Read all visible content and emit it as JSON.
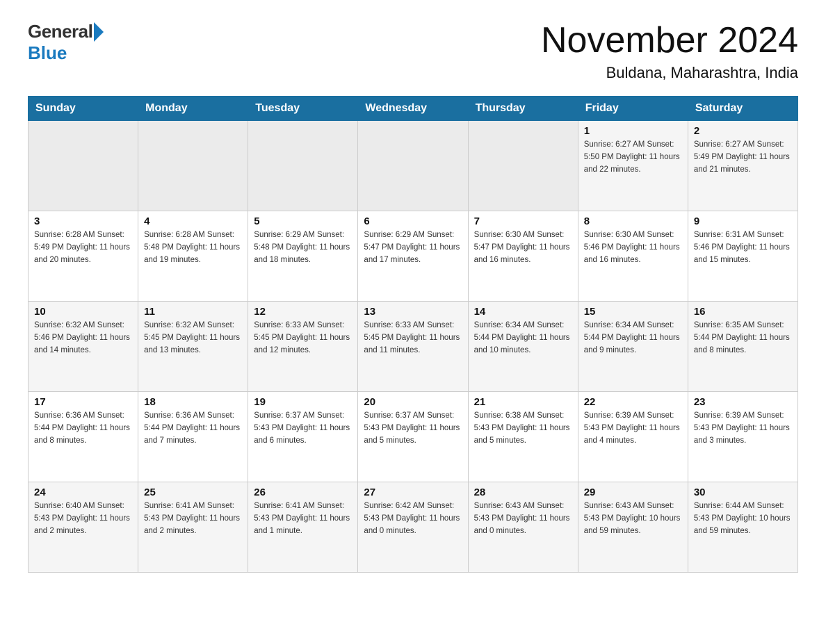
{
  "header": {
    "logo_general": "General",
    "logo_blue": "Blue",
    "month_title": "November 2024",
    "location": "Buldana, Maharashtra, India"
  },
  "days_of_week": [
    "Sunday",
    "Monday",
    "Tuesday",
    "Wednesday",
    "Thursday",
    "Friday",
    "Saturday"
  ],
  "weeks": [
    [
      {
        "day": "",
        "info": ""
      },
      {
        "day": "",
        "info": ""
      },
      {
        "day": "",
        "info": ""
      },
      {
        "day": "",
        "info": ""
      },
      {
        "day": "",
        "info": ""
      },
      {
        "day": "1",
        "info": "Sunrise: 6:27 AM\nSunset: 5:50 PM\nDaylight: 11 hours\nand 22 minutes."
      },
      {
        "day": "2",
        "info": "Sunrise: 6:27 AM\nSunset: 5:49 PM\nDaylight: 11 hours\nand 21 minutes."
      }
    ],
    [
      {
        "day": "3",
        "info": "Sunrise: 6:28 AM\nSunset: 5:49 PM\nDaylight: 11 hours\nand 20 minutes."
      },
      {
        "day": "4",
        "info": "Sunrise: 6:28 AM\nSunset: 5:48 PM\nDaylight: 11 hours\nand 19 minutes."
      },
      {
        "day": "5",
        "info": "Sunrise: 6:29 AM\nSunset: 5:48 PM\nDaylight: 11 hours\nand 18 minutes."
      },
      {
        "day": "6",
        "info": "Sunrise: 6:29 AM\nSunset: 5:47 PM\nDaylight: 11 hours\nand 17 minutes."
      },
      {
        "day": "7",
        "info": "Sunrise: 6:30 AM\nSunset: 5:47 PM\nDaylight: 11 hours\nand 16 minutes."
      },
      {
        "day": "8",
        "info": "Sunrise: 6:30 AM\nSunset: 5:46 PM\nDaylight: 11 hours\nand 16 minutes."
      },
      {
        "day": "9",
        "info": "Sunrise: 6:31 AM\nSunset: 5:46 PM\nDaylight: 11 hours\nand 15 minutes."
      }
    ],
    [
      {
        "day": "10",
        "info": "Sunrise: 6:32 AM\nSunset: 5:46 PM\nDaylight: 11 hours\nand 14 minutes."
      },
      {
        "day": "11",
        "info": "Sunrise: 6:32 AM\nSunset: 5:45 PM\nDaylight: 11 hours\nand 13 minutes."
      },
      {
        "day": "12",
        "info": "Sunrise: 6:33 AM\nSunset: 5:45 PM\nDaylight: 11 hours\nand 12 minutes."
      },
      {
        "day": "13",
        "info": "Sunrise: 6:33 AM\nSunset: 5:45 PM\nDaylight: 11 hours\nand 11 minutes."
      },
      {
        "day": "14",
        "info": "Sunrise: 6:34 AM\nSunset: 5:44 PM\nDaylight: 11 hours\nand 10 minutes."
      },
      {
        "day": "15",
        "info": "Sunrise: 6:34 AM\nSunset: 5:44 PM\nDaylight: 11 hours\nand 9 minutes."
      },
      {
        "day": "16",
        "info": "Sunrise: 6:35 AM\nSunset: 5:44 PM\nDaylight: 11 hours\nand 8 minutes."
      }
    ],
    [
      {
        "day": "17",
        "info": "Sunrise: 6:36 AM\nSunset: 5:44 PM\nDaylight: 11 hours\nand 8 minutes."
      },
      {
        "day": "18",
        "info": "Sunrise: 6:36 AM\nSunset: 5:44 PM\nDaylight: 11 hours\nand 7 minutes."
      },
      {
        "day": "19",
        "info": "Sunrise: 6:37 AM\nSunset: 5:43 PM\nDaylight: 11 hours\nand 6 minutes."
      },
      {
        "day": "20",
        "info": "Sunrise: 6:37 AM\nSunset: 5:43 PM\nDaylight: 11 hours\nand 5 minutes."
      },
      {
        "day": "21",
        "info": "Sunrise: 6:38 AM\nSunset: 5:43 PM\nDaylight: 11 hours\nand 5 minutes."
      },
      {
        "day": "22",
        "info": "Sunrise: 6:39 AM\nSunset: 5:43 PM\nDaylight: 11 hours\nand 4 minutes."
      },
      {
        "day": "23",
        "info": "Sunrise: 6:39 AM\nSunset: 5:43 PM\nDaylight: 11 hours\nand 3 minutes."
      }
    ],
    [
      {
        "day": "24",
        "info": "Sunrise: 6:40 AM\nSunset: 5:43 PM\nDaylight: 11 hours\nand 2 minutes."
      },
      {
        "day": "25",
        "info": "Sunrise: 6:41 AM\nSunset: 5:43 PM\nDaylight: 11 hours\nand 2 minutes."
      },
      {
        "day": "26",
        "info": "Sunrise: 6:41 AM\nSunset: 5:43 PM\nDaylight: 11 hours\nand 1 minute."
      },
      {
        "day": "27",
        "info": "Sunrise: 6:42 AM\nSunset: 5:43 PM\nDaylight: 11 hours\nand 0 minutes."
      },
      {
        "day": "28",
        "info": "Sunrise: 6:43 AM\nSunset: 5:43 PM\nDaylight: 11 hours\nand 0 minutes."
      },
      {
        "day": "29",
        "info": "Sunrise: 6:43 AM\nSunset: 5:43 PM\nDaylight: 10 hours\nand 59 minutes."
      },
      {
        "day": "30",
        "info": "Sunrise: 6:44 AM\nSunset: 5:43 PM\nDaylight: 10 hours\nand 59 minutes."
      }
    ]
  ]
}
